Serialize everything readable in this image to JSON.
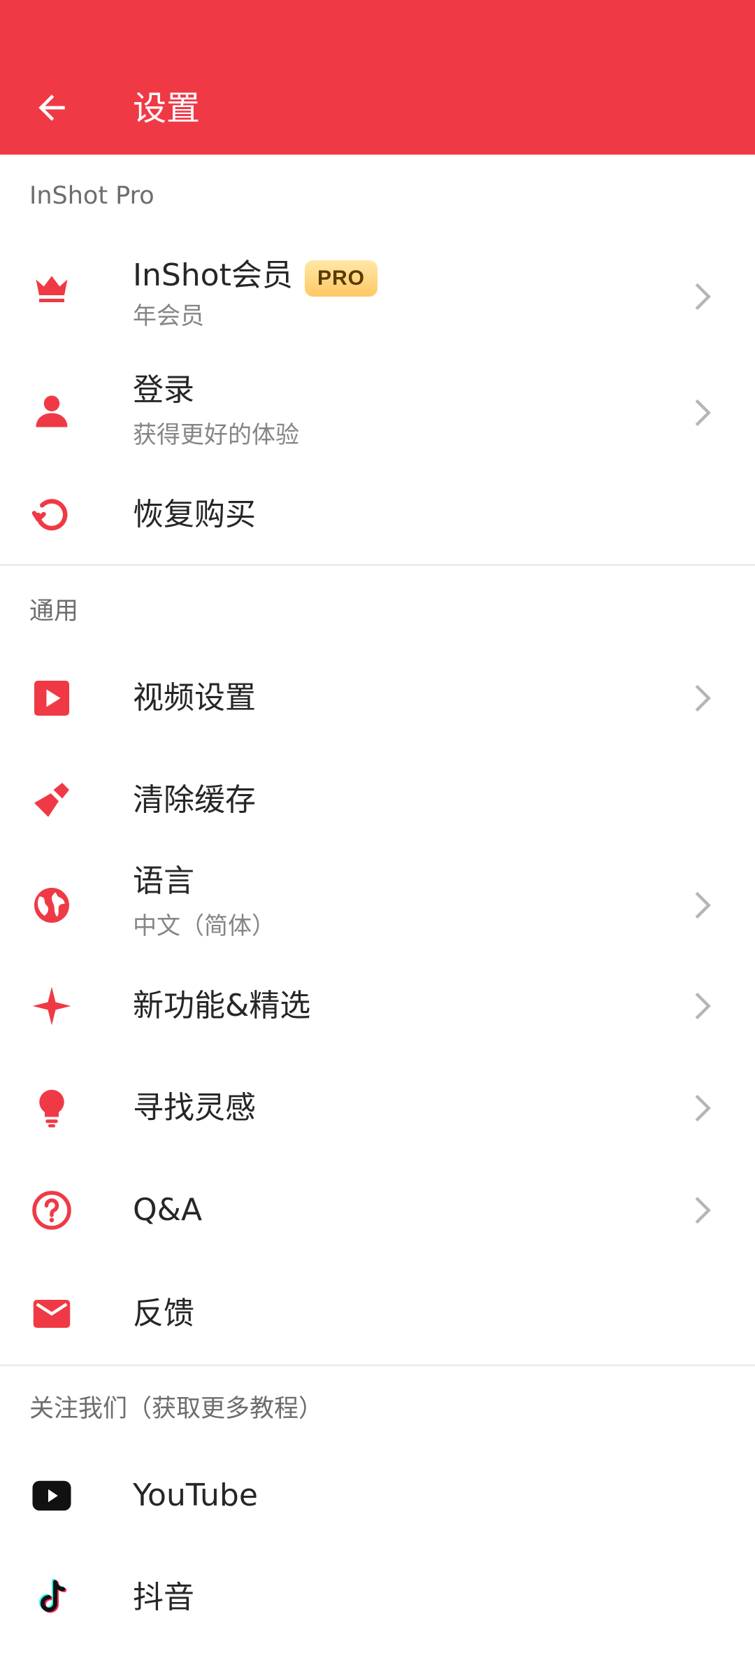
{
  "colors": {
    "accent": "#EF3A46",
    "text_primary": "#262626",
    "text_secondary": "#858585",
    "chevron": "#b5b5b5"
  },
  "header": {
    "title": "设置",
    "back_icon": "arrow-left-icon"
  },
  "sections": {
    "pro": {
      "header": "InShot Pro",
      "membership": {
        "label": "InShot会员",
        "badge": "PRO",
        "sub": "年会员",
        "icon": "crown-icon"
      },
      "login": {
        "label": "登录",
        "sub": "获得更好的体验",
        "icon": "person-icon"
      },
      "restore": {
        "label": "恢复购买",
        "icon": "restore-icon"
      }
    },
    "general": {
      "header": "通用",
      "video_settings": {
        "label": "视频设置",
        "icon": "play-square-icon"
      },
      "clear_cache": {
        "label": "清除缓存",
        "icon": "brush-icon"
      },
      "language": {
        "label": "语言",
        "sub": "中文（简体）",
        "icon": "globe-icon"
      },
      "new_features": {
        "label": "新功能&精选",
        "icon": "sparkle-icon"
      },
      "inspiration": {
        "label": "寻找灵感",
        "icon": "lightbulb-icon"
      },
      "qa": {
        "label": "Q&A",
        "icon": "question-circle-icon"
      },
      "feedback": {
        "label": "反馈",
        "icon": "mail-icon"
      }
    },
    "follow": {
      "header": "关注我们（获取更多教程）",
      "youtube": {
        "label": "YouTube",
        "icon": "youtube-icon"
      },
      "douyin": {
        "label": "抖音",
        "icon": "tiktok-icon"
      }
    }
  }
}
